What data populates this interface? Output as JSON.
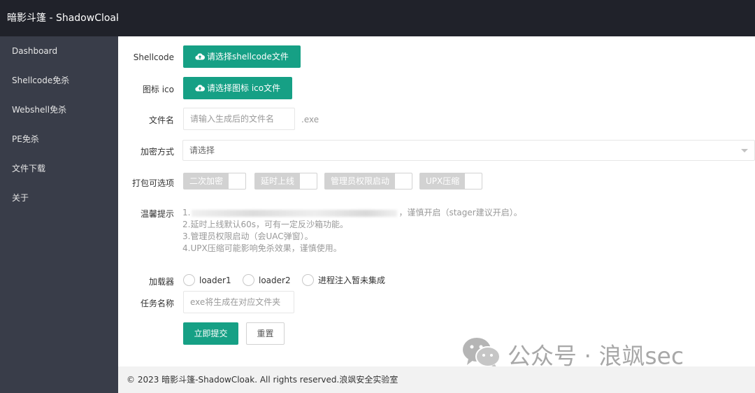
{
  "app": {
    "title": "暗影斗篷 - ShadowCloak"
  },
  "sidebar": {
    "items": [
      {
        "label": "Dashboard"
      },
      {
        "label": "Shellcode免杀"
      },
      {
        "label": "Webshell免杀"
      },
      {
        "label": "PE免杀"
      },
      {
        "label": "文件下载"
      },
      {
        "label": "关于"
      }
    ]
  },
  "form": {
    "shellcode": {
      "label": "Shellcode",
      "button": "请选择shellcode文件",
      "icon": "cloud-upload-icon"
    },
    "ico": {
      "label": "图标 ico",
      "button": "请选择图标 ico文件",
      "icon": "cloud-upload-icon"
    },
    "filename": {
      "label": "文件名",
      "placeholder": "请输入生成后的文件名",
      "suffix": ".exe"
    },
    "encryption": {
      "label": "加密方式",
      "placeholder": "请选择"
    },
    "pack": {
      "label": "打包可选项",
      "options": [
        "二次加密",
        "延时上线",
        "管理员权限启动",
        "UPX压缩"
      ]
    },
    "tips": {
      "label": "温馨提示",
      "line1_prefix": "1.",
      "line1_suffix": "，谨慎开启（stager建议开启）。",
      "line2": "2.延时上线默认60s，可有一定反沙箱功能。",
      "line3": "3.管理员权限启动（会UAC弹窗）。",
      "line4": "4.UPX压缩可能影响免杀效果，谨慎使用。"
    },
    "loader": {
      "label": "加载器",
      "options": [
        "loader1",
        "loader2",
        "进程注入暂未集成"
      ]
    },
    "task": {
      "label": "任务名称",
      "placeholder": "exe将生成在对应文件夹"
    },
    "submit": "立即提交",
    "reset": "重置"
  },
  "watermark": {
    "text": "公众号 · 浪飒sec"
  },
  "footer": {
    "text": "© 2023 暗影斗篷-ShadowCloak. All rights reserved.浪飒安全实验室"
  },
  "colors": {
    "accent": "#16a085",
    "sidebar": "#393d49",
    "header": "#20222a"
  }
}
